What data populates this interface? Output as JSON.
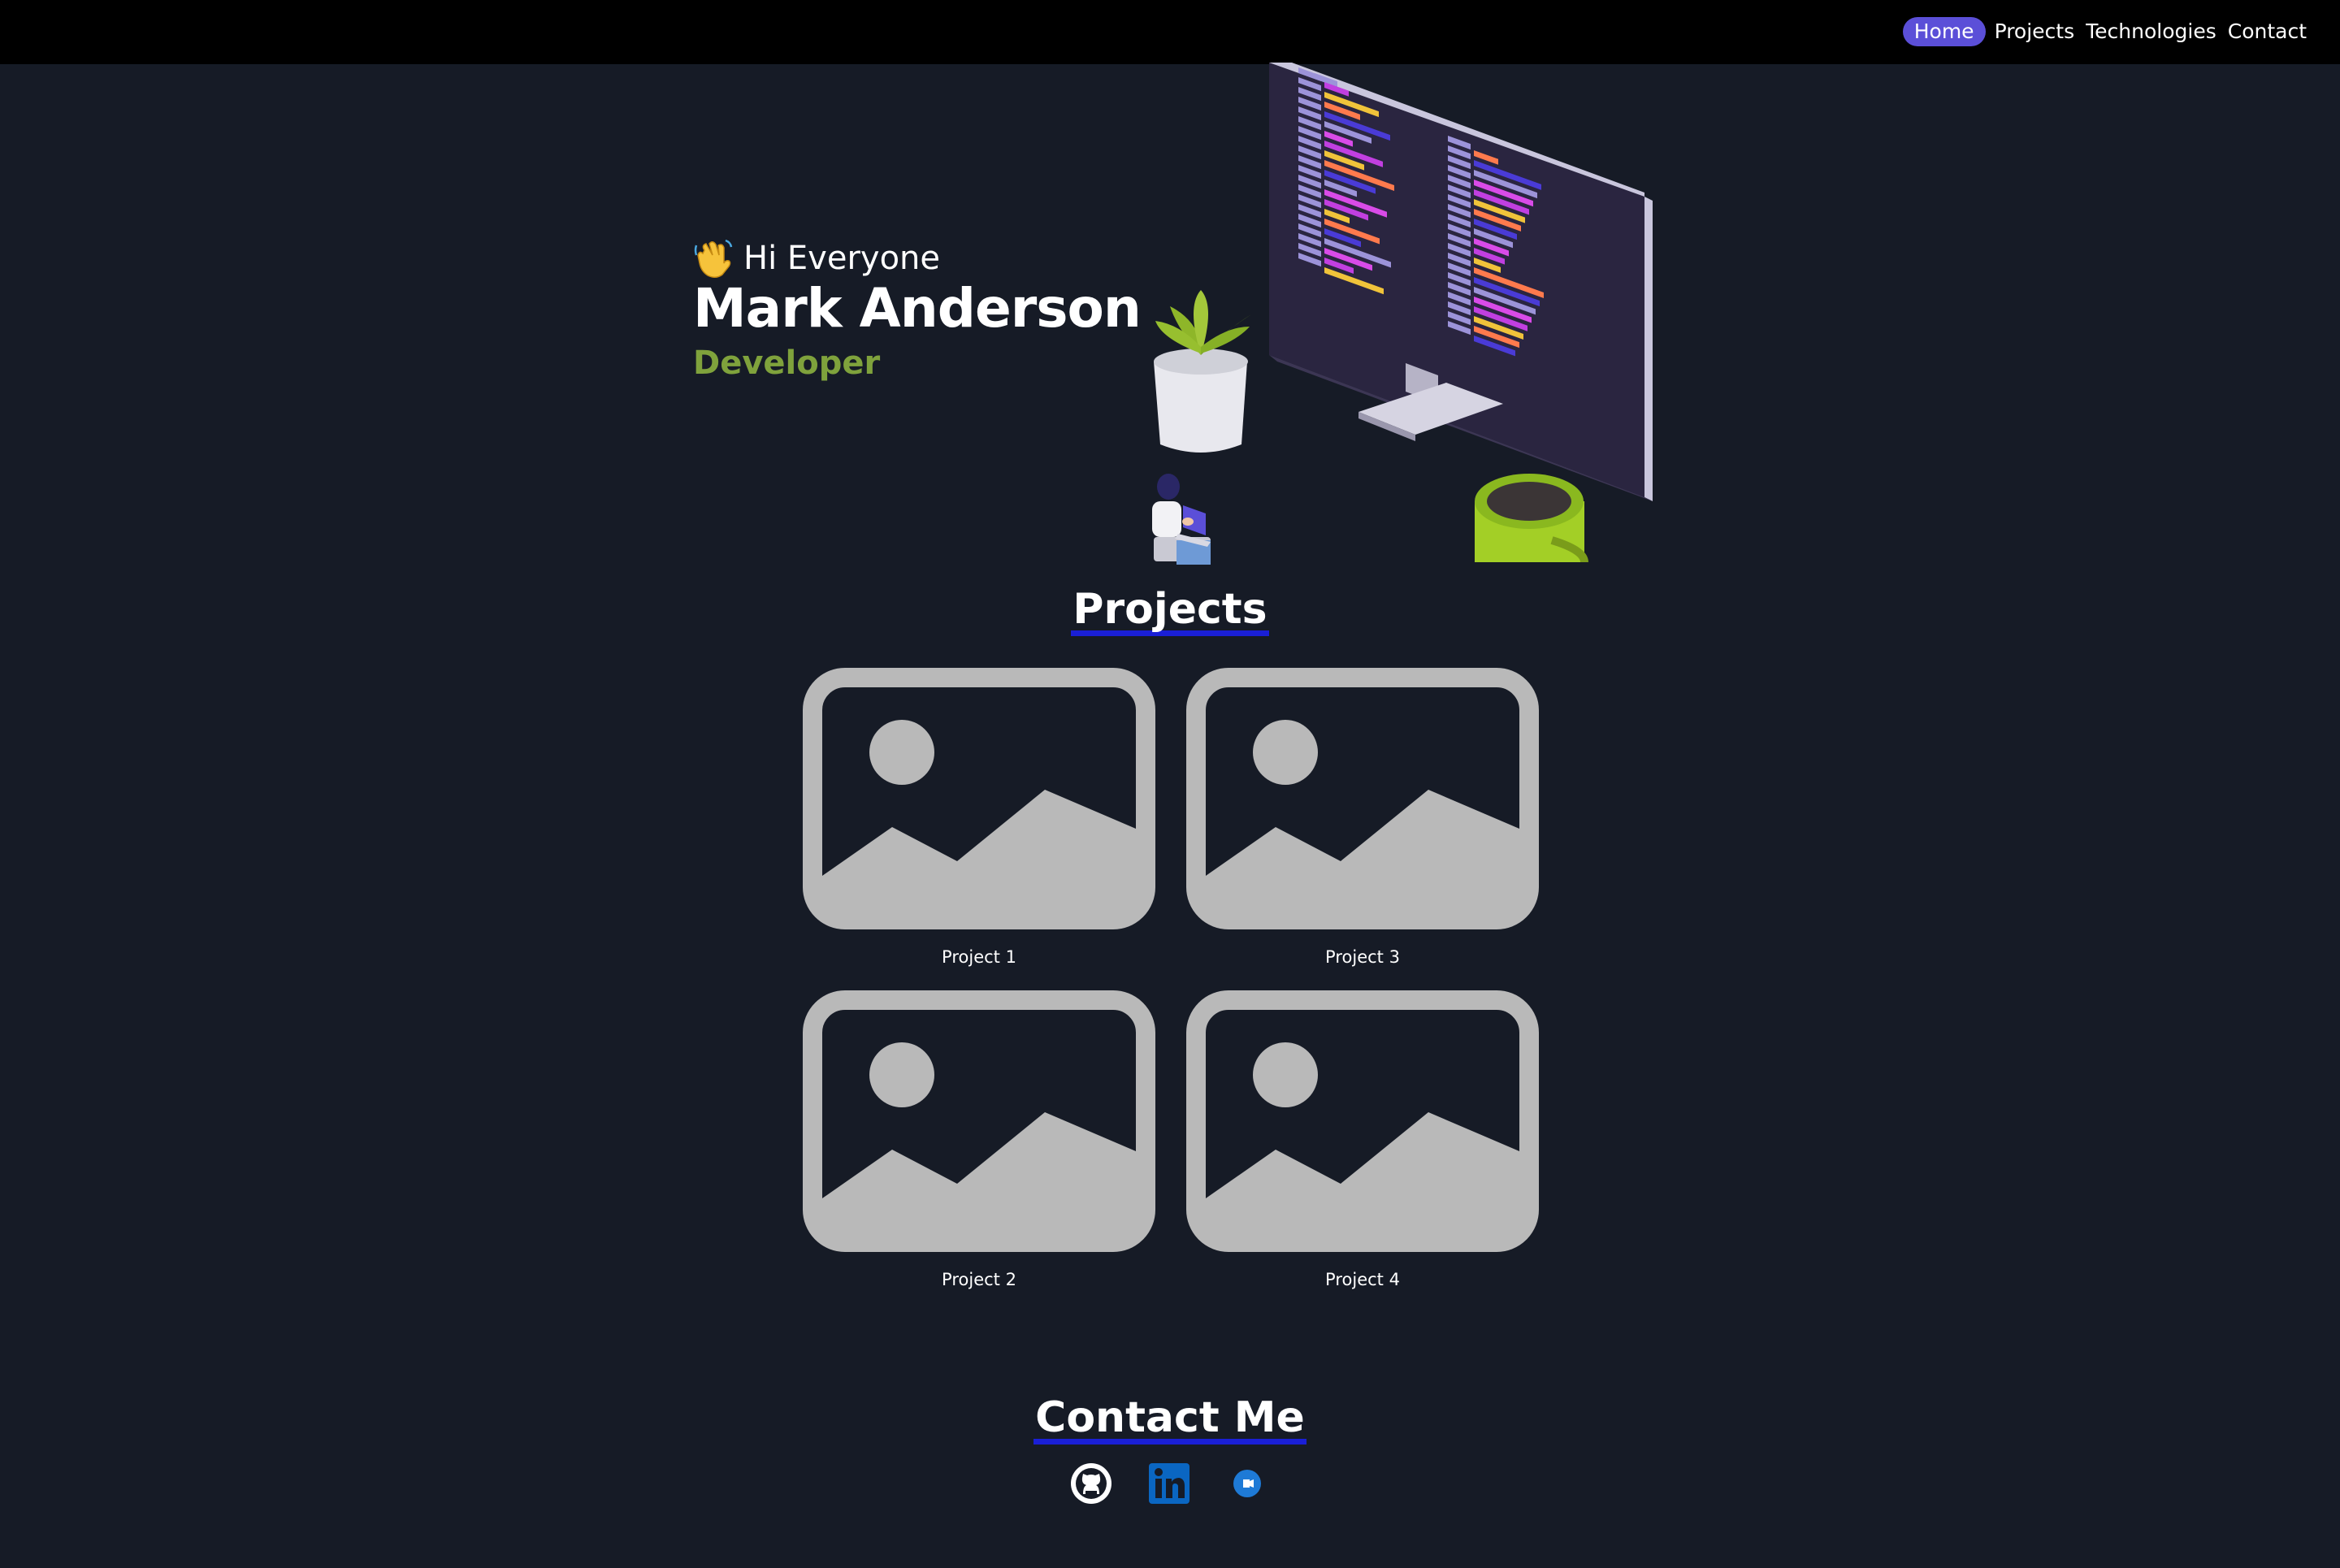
{
  "nav": {
    "items": [
      {
        "label": "Home",
        "active": true
      },
      {
        "label": "Projects",
        "active": false
      },
      {
        "label": "Technologies",
        "active": false
      },
      {
        "label": "Contact",
        "active": false
      }
    ]
  },
  "hero": {
    "greeting": "Hi Everyone",
    "name": "Mark Anderson",
    "role": "Developer"
  },
  "projects": {
    "title": "Projects",
    "items": [
      {
        "caption": "Project 1"
      },
      {
        "caption": "Project 3"
      },
      {
        "caption": "Project 2"
      },
      {
        "caption": "Project 4"
      }
    ]
  },
  "contact": {
    "title": "Contact Me",
    "links": [
      {
        "icon": "github-icon"
      },
      {
        "icon": "linkedin-icon"
      },
      {
        "icon": "chat-icon"
      }
    ]
  },
  "colors": {
    "background": "#161b26",
    "nav_bg": "#000000",
    "active_pill": "#5b4fd8",
    "role_text": "#7fa23c",
    "heading_underline": "#1a1fd6",
    "placeholder": "#b9b9b9"
  }
}
